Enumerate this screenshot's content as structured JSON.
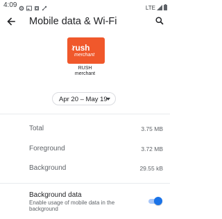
{
  "status_bar": {
    "time": "4:09",
    "network": "LTE",
    "icons_left": [
      "gear-icon",
      "photo-icon",
      "location-icon",
      "cast-icon"
    ],
    "icons_right": [
      "signal-icon",
      "battery-icon"
    ]
  },
  "app_bar": {
    "title": "Mobile data & Wi-Fi",
    "back_icon": "arrow-back-icon",
    "search_icon": "search-icon"
  },
  "app": {
    "logo_text_top": "rush",
    "logo_text_bottom": "merchant",
    "name_line1": "RUSH",
    "name_line2": "merchant",
    "brand_color": "#f0582b"
  },
  "date_range": {
    "label": "Apr 20 – May 19"
  },
  "usage": {
    "rows": [
      {
        "label": "Total",
        "value": "3.75 MB"
      },
      {
        "label": "Foreground",
        "value": "3.72 MB"
      },
      {
        "label": "Background",
        "value": "29.55 kB"
      }
    ]
  },
  "background_data": {
    "title": "Background data",
    "subtitle": "Enable usage of mobile data in the background",
    "enabled": true,
    "accent_color": "#1a73e8"
  }
}
